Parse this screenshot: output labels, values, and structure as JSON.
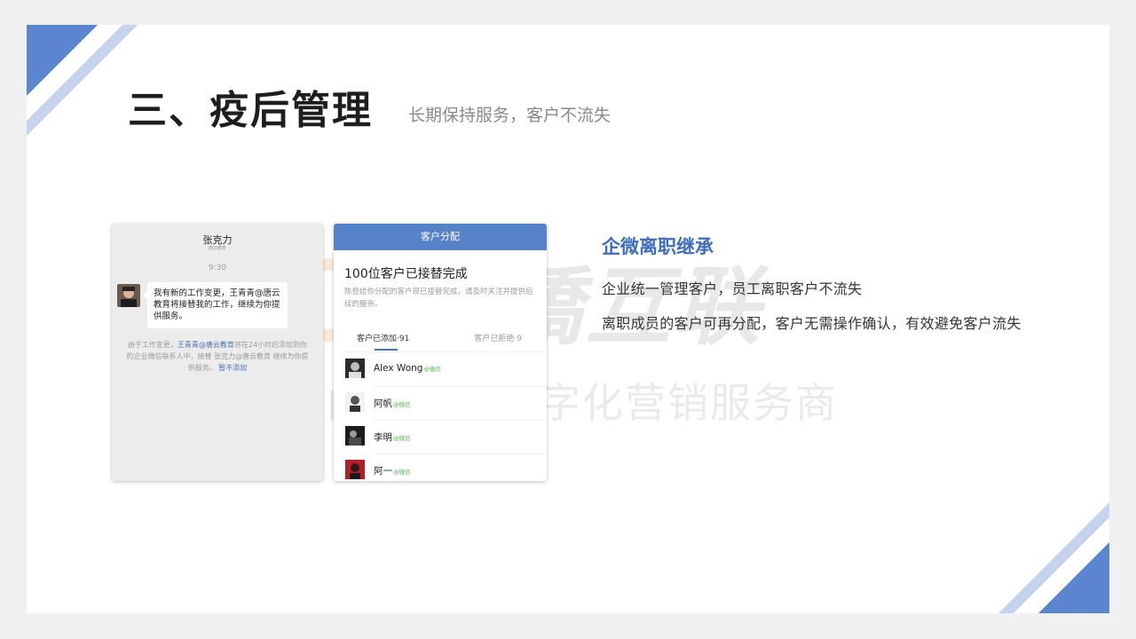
{
  "slide": {
    "title": "三、疫后管理",
    "subtitle": "长期保持服务，客户不流失"
  },
  "watermark": {
    "brand": "美橋互联",
    "tagline": "国内领先的数字化营销服务商"
  },
  "chat": {
    "contact_name": "张克力",
    "contact_org": "唐云教育",
    "time": "9:30",
    "message": "我有新的工作变更，王青青@唐云教育将接替我的工作，继续为你提供服务。",
    "notice_prefix": "由于工作变更，",
    "notice_highlight": "王青青@唐云教育",
    "notice_middle": "将在24小时后添加到你的企业微信联系人中，接替 张克力@唐云教育 继续为你提供服务。",
    "notice_link": "暂不添加"
  },
  "assign": {
    "header": "客户分配",
    "heading": "100位客户已接替完成",
    "description": "陈登给你分配的客户现已接替完成，请及时关注并提供后续的服务。",
    "tab_added": "客户已添加·91",
    "tab_rejected": "客户已拒绝·9",
    "customers": [
      {
        "name": "Alex Wong",
        "source": "@微信"
      },
      {
        "name": "阿帆",
        "source": "@微信"
      },
      {
        "name": "李明",
        "source": "@微信"
      },
      {
        "name": "阿一",
        "source": "@微信"
      }
    ]
  },
  "feature": {
    "title": "企微离职继承",
    "line1": "企业统一管理客户，员工离职客户不流失",
    "line2": "离职成员的客户可再分配，客户无需操作确认，有效避免客户流失"
  },
  "colors": {
    "accent": "#3d6cc0",
    "header_blue": "#5683c8",
    "deco_dark": "#5b86cf",
    "deco_light": "#c5d3ee"
  }
}
